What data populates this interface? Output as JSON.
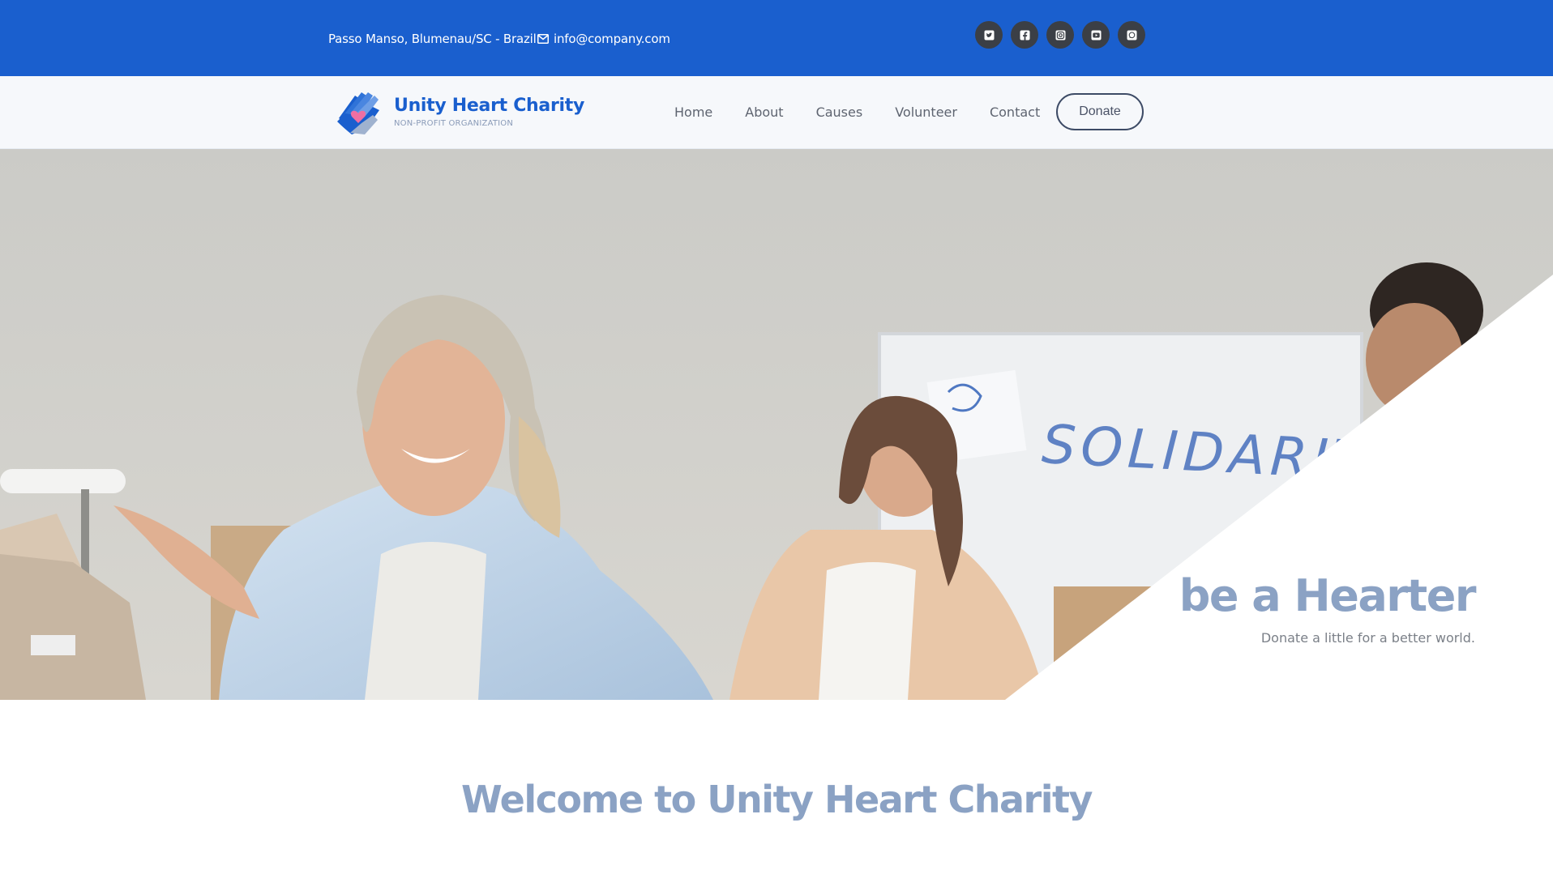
{
  "topbar": {
    "address": "Passo Manso, Blumenau/SC - Brazil",
    "email": "info@company.com",
    "socials": [
      "twitter-icon",
      "facebook-icon",
      "instagram-icon",
      "youtube-icon",
      "whatsapp-icon"
    ]
  },
  "brand": {
    "name": "Unity Heart Charity",
    "tagline": "NON-PROFIT ORGANIZATION"
  },
  "nav": {
    "items": [
      "Home",
      "About",
      "Causes",
      "Volunteer",
      "Contact"
    ],
    "donate": "Donate"
  },
  "hero": {
    "board_text": "SOLIDARITY",
    "title": "be a Hearter",
    "subtitle": "Donate a little for a better world."
  },
  "welcome": {
    "title": "Welcome to Unity Heart Charity"
  },
  "colors": {
    "topbar_bg": "#1a5fce",
    "brand": "#1a5fce",
    "accent_text": "#8ba2c4",
    "social_bg": "#3b3f46"
  }
}
